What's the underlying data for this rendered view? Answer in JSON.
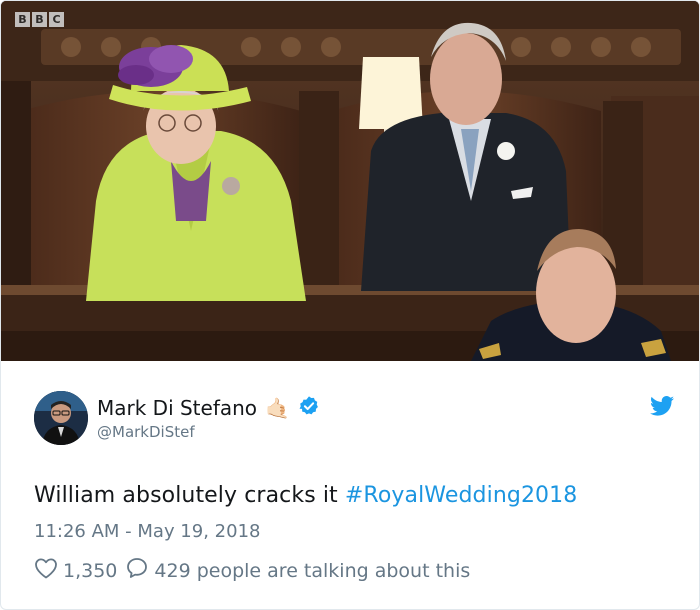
{
  "media": {
    "watermark": [
      "B",
      "B",
      "C"
    ]
  },
  "tweet": {
    "author_name": "Mark Di Stefano",
    "author_handle": "@MarkDiStef",
    "emoji": "🤙🏻",
    "text": "William absolutely cracks it ",
    "hashtag": "#RoyalWedding2018",
    "timestamp": "11:26 AM - May 19, 2018",
    "likes": "1,350",
    "replies_text": "429 people are talking about this"
  },
  "colors": {
    "link": "#1b95e0",
    "verified": "#1da1f2",
    "muted": "#657786",
    "text": "#14171a"
  },
  "icons": [
    "verified-badge-icon",
    "twitter-bird-icon",
    "heart-icon",
    "comment-bubble-icon"
  ]
}
